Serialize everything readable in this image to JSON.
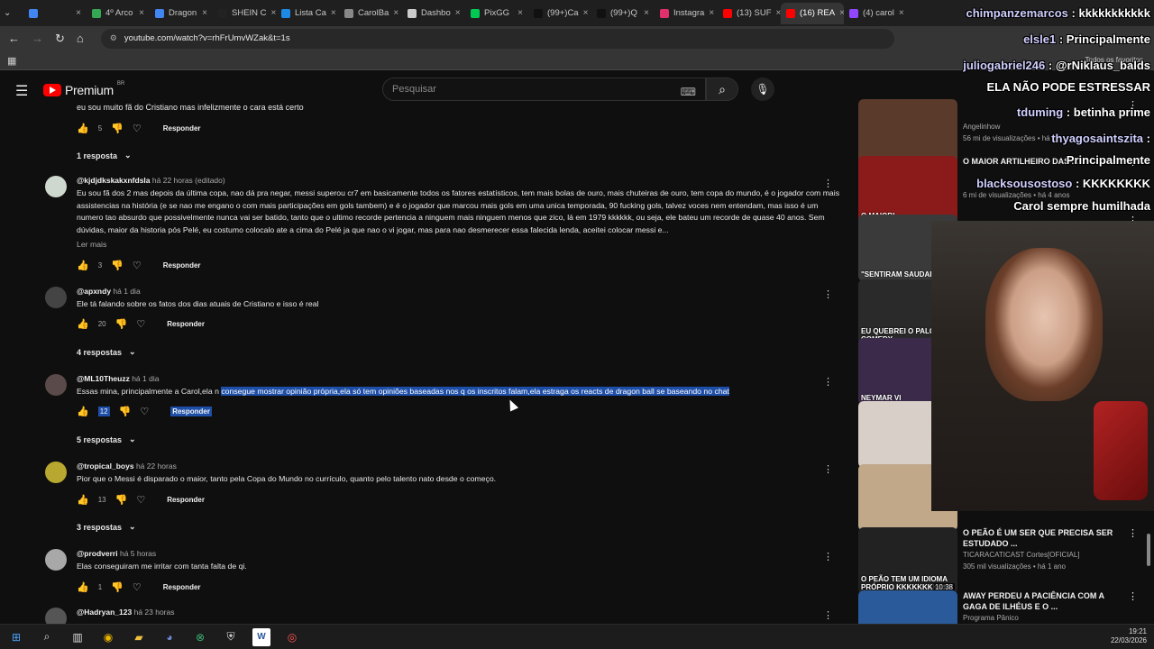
{
  "browser": {
    "tabs": [
      {
        "label": "",
        "color": "#4285f4"
      },
      {
        "label": "4º Arco",
        "color": "#34a853"
      },
      {
        "label": "Dragon",
        "color": "#4285f4"
      },
      {
        "label": "SHEIN C",
        "color": "#222"
      },
      {
        "label": "Lista Ca",
        "color": "#1e88e5"
      },
      {
        "label": "CarolBa",
        "color": "#888"
      },
      {
        "label": "Dashbo",
        "color": "#ccc"
      },
      {
        "label": "PixGG",
        "color": "#00c853"
      },
      {
        "label": "(99+)Ca",
        "color": "#111"
      },
      {
        "label": "(99+)Q",
        "color": "#111"
      },
      {
        "label": "Instagra",
        "color": "#e1306c"
      },
      {
        "label": "(13) SUF",
        "color": "#ff0000"
      },
      {
        "label": "(16) REA",
        "color": "#ff0000"
      },
      {
        "label": "(4) carol",
        "color": "#9146ff"
      }
    ],
    "active_tab_index": 12,
    "url": "youtube.com/watch?v=rhFrUmvWZak&t=1s",
    "bookmarks_label": "Todos os favoritos"
  },
  "youtube": {
    "logo_text": "Premium",
    "logo_region": "BR",
    "search_placeholder": "Pesquisar"
  },
  "comments": {
    "top_line": "eu sou muito fã do Cristiano mas infelizmente o cara está certo",
    "top_likes": "5",
    "reply_label": "Responder",
    "first_replies": "1 resposta",
    "items": [
      {
        "author": "@kjdjdkskakxnfdsla",
        "time": "há 22 horas (editado)",
        "text": "Eu sou fã dos 2 mas depois da última copa, nao dá pra negar, messi superou cr7 em basicamente todos os fatores estatísticos, tem mais bolas de ouro, mais chuteiras de ouro, tem copa do mundo, é o jogador com mais assistencias na história (e se nao me engano o com mais participações em gols tambem) e é o jogador que marcou mais gols em uma unica temporada, 90 fucking gols, talvez voces nem entendam, mas isso é um numero tao absurdo que possivelmente nunca vai ser batido, tanto que o ultimo recorde pertencia a ninguem mais ninguem menos que zico, lá em 1979 kkkkkk, ou seja, ele bateu um recorde de quase 40 anos. Sem dúvidas, maior da historia pós Pelé, eu costumo colocalo ate a cima do Pelé ja que nao o vi jogar, mas para nao desmerecer essa falecida lenda, aceitei colocar messi e...",
        "read_more": "Ler mais",
        "likes": "3",
        "replies": ""
      },
      {
        "author": "@apxndy",
        "time": "há 1 dia",
        "text": "Ele tá falando sobre os fatos dos dias atuais de Cristiano e isso é real",
        "likes": "20",
        "replies": "4 respostas"
      },
      {
        "author": "@ML10Theuzz",
        "time": "há 1 dia",
        "text_plain": "Essas mina, principalmente a Carol,ela n ",
        "text_highlight": "consegue mostrar opinião própria,ela só tem opiniões baseadas nos q os inscritos falam,ela estraga os reacts de dragon ball se baseando no chat",
        "likes": "12",
        "replies": "5 respostas"
      },
      {
        "author": "@tropical_boys",
        "time": "há 22 horas",
        "text": "Pior que o Messi é disparado o maior, tanto pela Copa do Mundo no currículo, quanto pelo talento nato desde o começo.",
        "likes": "13",
        "replies": "3 respostas"
      },
      {
        "author": "@prodverri",
        "time": "há 5 horas",
        "text": "Elas conseguiram me irritar com tanta falta de qi.",
        "likes": "1",
        "replies": ""
      },
      {
        "author": "@Hadryan_123",
        "time": "há 23 horas",
        "text": "",
        "likes": "",
        "replies": ""
      }
    ]
  },
  "sidebar": {
    "videos": [
      {
        "thumb_text": "",
        "title": "",
        "channel": "Angelinhow",
        "views": "56 mi de visualizações",
        "ago": "há",
        "color": "#5a3a2a"
      },
      {
        "thumb_text": "O MAIOR!",
        "title": "O MAIOR ARTILHEIRO DAS ...",
        "channel": "",
        "views": "6 mi de visualizações",
        "ago": "há 4 anos",
        "color": "#8b1a1a"
      },
      {
        "thumb_text": "\"SENTIRAM SAUDADES\"",
        "title": "",
        "channel": "",
        "views": "",
        "ago": "",
        "color": "#3a3a3a"
      },
      {
        "thumb_text": "EU QUEBREI O PALCO DO COMEDY",
        "title": "",
        "channel": "",
        "views": "",
        "ago": "",
        "color": "#2a2a2a"
      },
      {
        "thumb_text": "NEYMAR VI",
        "title": "",
        "channel": "",
        "views": "",
        "ago": "",
        "color": "#3b2a4a"
      },
      {
        "thumb_text": "",
        "title": "",
        "channel": "",
        "views": "",
        "ago": "",
        "color": "#d8d0c8"
      },
      {
        "thumb_text": "",
        "title": "",
        "channel": "",
        "views": "",
        "ago": "",
        "color": "#c0a888"
      },
      {
        "thumb_text": "O PEÃO TEM UM IDIOMA PRÓPRIO KKKKKKKKKKK",
        "duration": "10:38",
        "title": "O PEÃO É UM SER QUE PRECISA SER ESTUDADO ...",
        "channel": "TICARACATICAST Cortes[OFICIAL]",
        "views": "305 mil visualizações",
        "ago": "há 1 ano",
        "color": "#222"
      },
      {
        "thumb_text": "",
        "title": "AWAY PERDEU A PACIÊNCIA COM A GAGA DE ILHÉUS E O ...",
        "channel": "Programa Pânico",
        "views": "",
        "ago": "",
        "color": "#2a5a9a"
      }
    ]
  },
  "chat_overlay": [
    {
      "user": "chimpanzemarcos",
      "msg": "kkkkkkkkkkk"
    },
    {
      "user": "elsle1",
      "msg": "Principalmente"
    },
    {
      "user": "juliogabriel246",
      "msg": "@rNiklaus_balds"
    },
    {
      "user": "",
      "msg": "ELA NÃO PODE ESTRESSAR"
    },
    {
      "user": "tduming",
      "msg": "betinha prime"
    },
    {
      "user": "thyagosaintszita",
      "msg": ""
    },
    {
      "user": "",
      "msg": "Principalmente"
    },
    {
      "user": "blacksousostoso",
      "msg": "KKKKKKKK"
    },
    {
      "user": "",
      "msg": "Carol sempre humilhada"
    }
  ],
  "taskbar": {
    "time": "19:21",
    "date": "22/03/2026"
  }
}
